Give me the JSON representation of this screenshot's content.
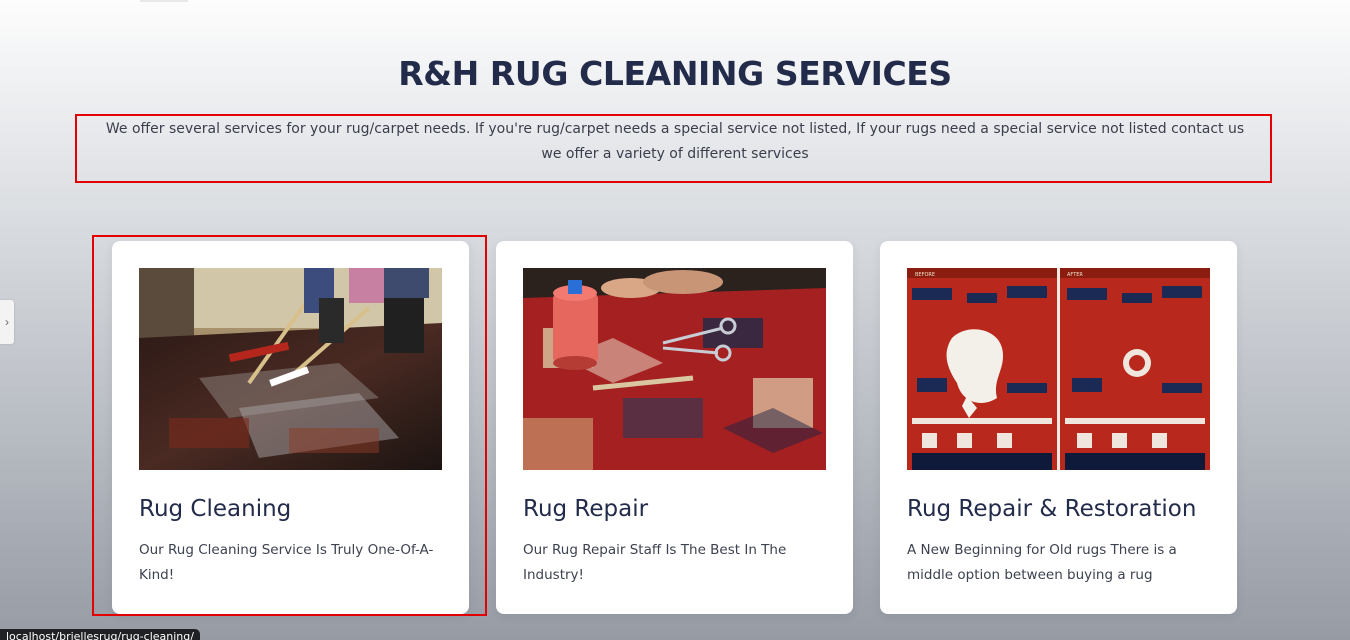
{
  "section": {
    "title": "R&H RUG CLEANING SERVICES",
    "intro": "We offer several services for your rug/carpet needs. If you're rug/carpet needs a special service not listed, If your rugs need a special service not listed contact us we offer a variety of different services"
  },
  "cards": [
    {
      "title": "Rug Cleaning",
      "description": "Our Rug Cleaning Service Is Truly One-Of-A-Kind!"
    },
    {
      "title": "Rug Repair",
      "description": "Our Rug Repair Staff Is The Best In The Industry!"
    },
    {
      "title": "Rug Repair & Restoration",
      "description": "A New Beginning for Old rugs There is a middle option between buying a rug",
      "image_labels": {
        "before": "BEFORE",
        "after": "AFTER"
      }
    }
  ],
  "status_bar": {
    "url": "localhost/briellesrug/rug-cleaning/"
  },
  "colors": {
    "heading": "#232b4a",
    "highlight_border": "#e30000",
    "card_background": "#ffffff"
  },
  "icons": {
    "side_tab": "chevron-right-icon"
  }
}
